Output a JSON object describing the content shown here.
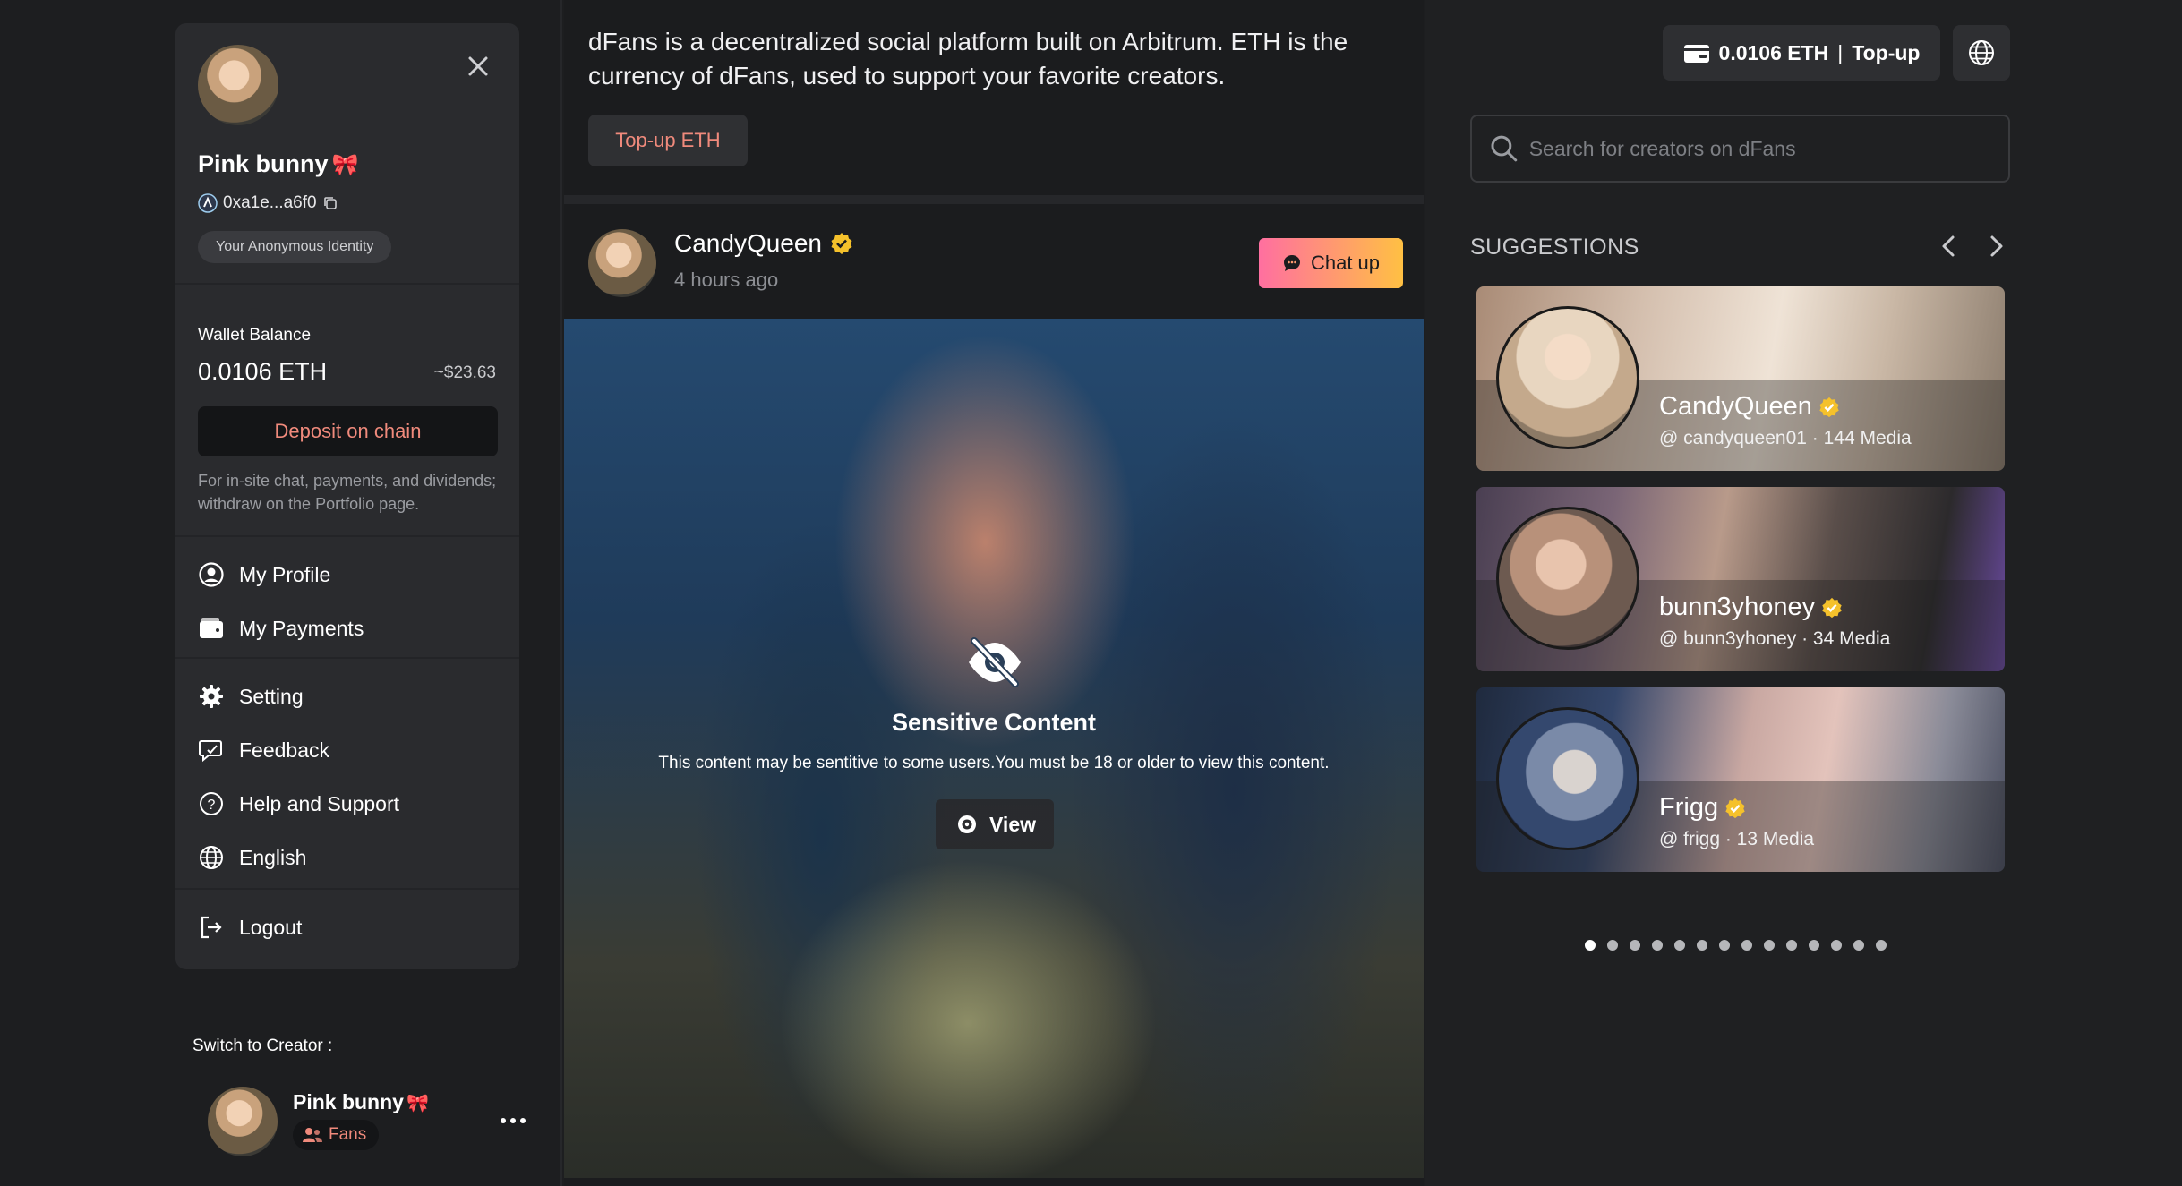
{
  "profile": {
    "name": "Pink bunny",
    "address": "0xa1e...a6f0",
    "anon_label": "Your Anonymous Identity"
  },
  "wallet": {
    "label": "Wallet Balance",
    "value": "0.0106 ETH",
    "usd": "~$23.63",
    "deposit_label": "Deposit on chain",
    "note": "For in-site chat, payments, and dividends; withdraw on the Portfolio page."
  },
  "menu": {
    "items": [
      {
        "label": "My Profile",
        "icon": "user-circle-icon"
      },
      {
        "label": "My Payments",
        "icon": "wallet-icon"
      },
      {
        "label": "Setting",
        "icon": "gear-icon"
      },
      {
        "label": "Feedback",
        "icon": "feedback-icon"
      },
      {
        "label": "Help and Support",
        "icon": "help-icon"
      },
      {
        "label": "English",
        "icon": "globe-icon"
      },
      {
        "label": "Logout",
        "icon": "logout-icon"
      }
    ]
  },
  "switch": {
    "label": "Switch to Creator :",
    "name": "Pink bunny",
    "badge": "Fans"
  },
  "feed": {
    "intro": "dFans is a decentralized social platform built on Arbitrum. ETH is the currency of dFans, used to support your favorite creators.",
    "topup_label": "Top-up ETH",
    "post": {
      "author": "CandyQueen",
      "time": "4 hours ago",
      "chat_label": "Chat up",
      "sensitive_title": "Sensitive Content",
      "sensitive_text": "This content may be sentitive to some users.You must be 18 or older to view this content.",
      "view_label": "View"
    }
  },
  "topbar": {
    "balance": "0.0106 ETH",
    "topup": "Top-up"
  },
  "search": {
    "placeholder": "Search for creators on dFans"
  },
  "suggestions": {
    "title": "SUGGESTIONS",
    "cards": [
      {
        "name": "CandyQueen",
        "meta": "@ candyqueen01 · 144 Media"
      },
      {
        "name": "bunn3yhoney",
        "meta": "@ bunn3yhoney · 34 Media"
      },
      {
        "name": "Frigg",
        "meta": "@ frigg · 13 Media"
      }
    ],
    "page_count": 14,
    "active_page": 1
  },
  "colors": {
    "accent": "#f08a7c",
    "verified": "#f5c12b",
    "chat_gradient_start": "#ff6fa0",
    "chat_gradient_end": "#ffc043"
  }
}
